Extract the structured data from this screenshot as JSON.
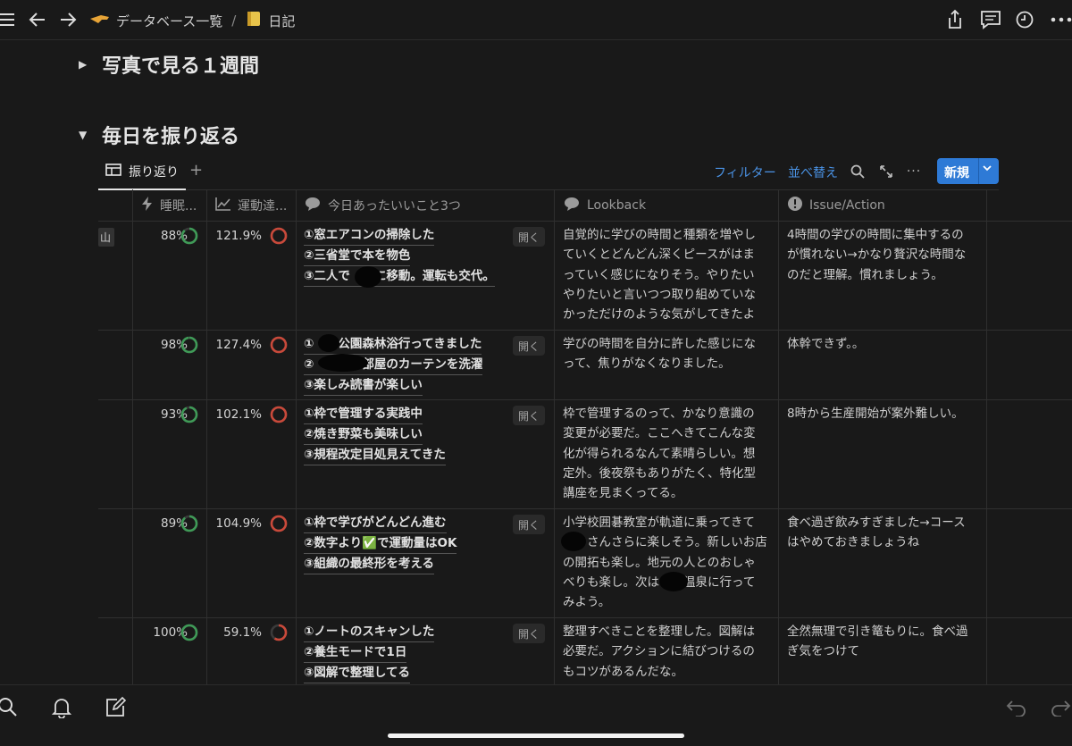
{
  "breadcrumb": {
    "parent": "データベース一覧",
    "separator": "/",
    "current": "日記"
  },
  "sections": [
    {
      "title": "写真で見る１週間",
      "collapsed": true
    },
    {
      "title": "毎日を振り返る",
      "collapsed": false
    }
  ],
  "view": {
    "tab_label": "振り返り",
    "add": "+",
    "filter": "フィルター",
    "sort": "並べ替え",
    "more": "···",
    "new_label": "新規"
  },
  "columns": {
    "sleep": "睡眠...",
    "exercise": "運動達...",
    "good": "今日あったいいこと3つ",
    "lookback": "Lookback",
    "issue": "Issue/Action"
  },
  "open_label": "開く",
  "rows": [
    {
      "tag": "山",
      "sleep": "88%",
      "sleep_ratio": 0.88,
      "exercise": "121.9%",
      "exercise_ratio": 1.219,
      "good": [
        "①窓エアコンの掃除した",
        "②三省堂で本を物色",
        "③二人で　　に移動。運転も交代。"
      ],
      "lookback": [
        "自覚的に学びの時間と種類を増やし",
        "ていくとどんどん深くピースがはま",
        "っていく感じになりそう。やりたい",
        "やりたいと言いつつ取り組めていな",
        "かっただけのような気がしてきたよ"
      ],
      "issue": [
        "4時間の学びの時間に集中するの",
        "が慣れない→かなり贅沢な時間な",
        "のだと理解。慣れましょう。"
      ]
    },
    {
      "tag": "",
      "sleep": "98%",
      "sleep_ratio": 0.98,
      "exercise": "127.4%",
      "exercise_ratio": 1.274,
      "good": [
        "①　　公園森林浴行ってきました",
        "②　　　　部屋のカーテンを洗濯",
        "③楽しみ読書が楽しい"
      ],
      "lookback": [
        "学びの時間を自分に許した感じにな",
        "って、焦りがなくなりました。"
      ],
      "issue": [
        "体幹できず。。"
      ]
    },
    {
      "tag": "",
      "sleep": "93%",
      "sleep_ratio": 0.93,
      "exercise": "102.1%",
      "exercise_ratio": 1.021,
      "good": [
        "①枠で管理する実践中",
        "②焼き野菜も美味しい",
        "③規程改定目処見えてきた"
      ],
      "lookback": [
        "枠で管理するのって、かなり意識の",
        "変更が必要だ。ここへきてこんな変",
        "化が得られるなんて素晴らしい。想",
        "定外。後夜祭もありがたく、特化型",
        "講座を見まくってる。"
      ],
      "issue": [
        "8時から生産開始が案外難しい。"
      ]
    },
    {
      "tag": "",
      "sleep": "89%",
      "sleep_ratio": 0.89,
      "exercise": "104.9%",
      "exercise_ratio": 1.049,
      "good": [
        "①枠で学びがどんどん進む",
        "②数字より✅で運動量はOK",
        "③組織の最終形を考える"
      ],
      "lookback": [
        "小学校囲碁教室が軌道に乗ってきて",
        "　　さんさらに楽しそう。新しいお店",
        "の開拓も楽し。地元の人とのおしゃ",
        "べりも楽し。次は　　温泉に行って",
        "みよう。"
      ],
      "issue": [
        "食べ過ぎ飲みすぎました→コース",
        "はやめておきましょうね"
      ]
    },
    {
      "tag": "",
      "sleep": "100%",
      "sleep_ratio": 1.0,
      "exercise": "59.1%",
      "exercise_ratio": 0.591,
      "good": [
        "①ノートのスキャンした",
        "②養生モードで1日",
        "③図解で整理してる"
      ],
      "lookback": [
        "整理すべきことを整理した。図解は",
        "必要だ。アクションに結びつけるの",
        "もコツがあるんだな。"
      ],
      "issue": [
        "全然無理で引き篭もりに。食べ過",
        "ぎ気をつけて"
      ]
    }
  ],
  "colors": {
    "accent": "#2e7ad6",
    "link": "#4a93e6",
    "sleep_ring": "#3f9a57",
    "exercise_ring": "#c9493a"
  }
}
